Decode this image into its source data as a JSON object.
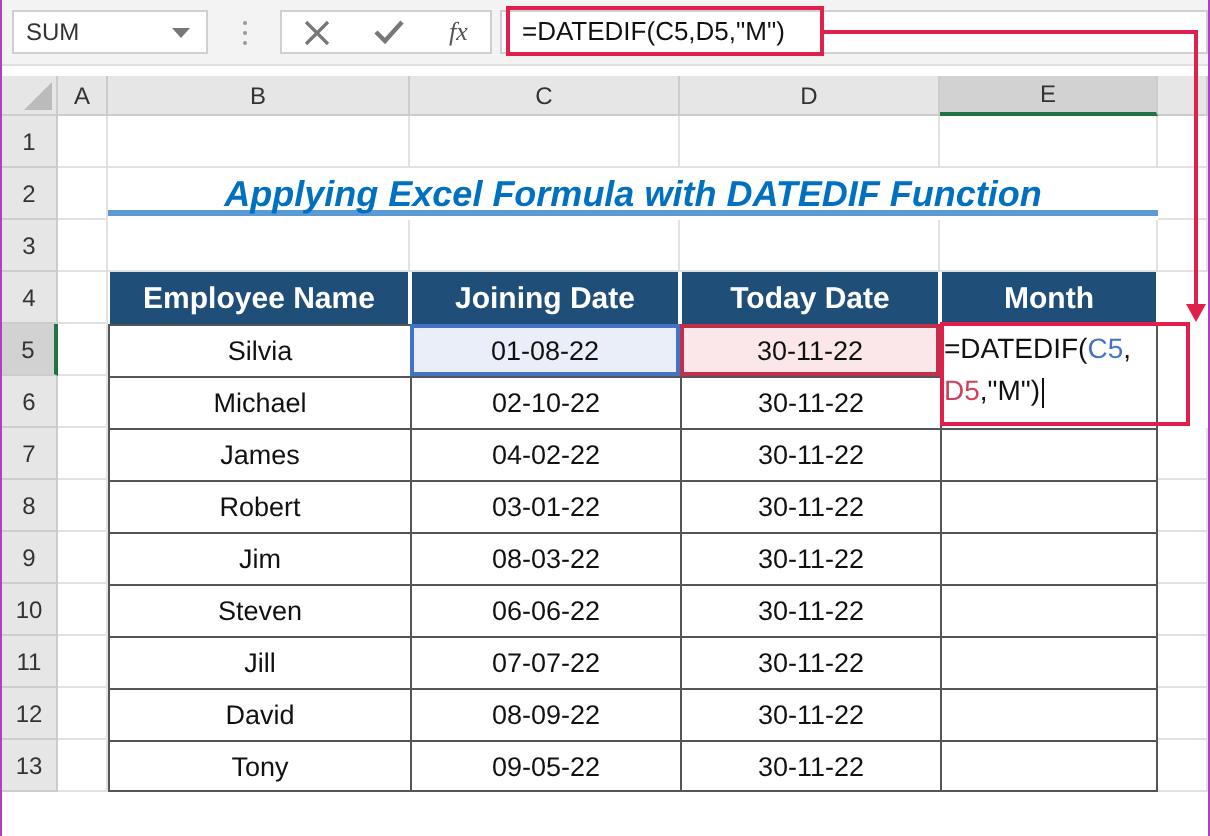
{
  "name_box": "SUM",
  "insert_function": "fx",
  "formula_bar": "=DATEDIF(C5,D5,\"M\")",
  "columns": [
    {
      "label": "A",
      "selected": false
    },
    {
      "label": "B",
      "selected": false
    },
    {
      "label": "C",
      "selected": false
    },
    {
      "label": "D",
      "selected": false
    },
    {
      "label": "E",
      "selected": true
    }
  ],
  "row_headers": [
    {
      "label": "1",
      "selected": false
    },
    {
      "label": "2",
      "selected": false
    },
    {
      "label": "3",
      "selected": false
    },
    {
      "label": "4",
      "selected": false
    },
    {
      "label": "5",
      "selected": true
    },
    {
      "label": "6",
      "selected": false
    },
    {
      "label": "7",
      "selected": false
    },
    {
      "label": "8",
      "selected": false
    },
    {
      "label": "9",
      "selected": false
    },
    {
      "label": "10",
      "selected": false
    },
    {
      "label": "11",
      "selected": false
    },
    {
      "label": "12",
      "selected": false
    },
    {
      "label": "13",
      "selected": false
    }
  ],
  "title": "Applying Excel Formula with DATEDIF Function",
  "table": {
    "columns": [
      "Employee Name",
      "Joining Date",
      "Today Date",
      "Month"
    ],
    "rows": [
      {
        "name": "Silvia",
        "joining": "01-08-22",
        "today": "30-11-22",
        "joining_highlighted": true,
        "today_highlighted": true,
        "month_formula": [
          [
            {
              "text": "=DATEDIF("
            },
            {
              "text": "C5",
              "color": "#4472c4"
            },
            {
              "text": ","
            }
          ],
          [
            {
              "text": "D5",
              "color": "#d0405a"
            },
            {
              "text": ",\"M\")"
            }
          ]
        ]
      },
      {
        "name": "Michael",
        "joining": "02-10-22",
        "today": "30-11-22",
        "joining_highlighted": false,
        "today_highlighted": false
      },
      {
        "name": "James",
        "joining": "04-02-22",
        "today": "30-11-22",
        "joining_highlighted": false,
        "today_highlighted": false
      },
      {
        "name": "Robert",
        "joining": "03-01-22",
        "today": "30-11-22",
        "joining_highlighted": false,
        "today_highlighted": false
      },
      {
        "name": "Jim",
        "joining": "08-03-22",
        "today": "30-11-22",
        "joining_highlighted": false,
        "today_highlighted": false
      },
      {
        "name": "Steven",
        "joining": "06-06-22",
        "today": "30-11-22",
        "joining_highlighted": false,
        "today_highlighted": false
      },
      {
        "name": "Jill",
        "joining": "07-07-22",
        "today": "30-11-22",
        "joining_highlighted": false,
        "today_highlighted": false
      },
      {
        "name": "David",
        "joining": "08-09-22",
        "today": "30-11-22",
        "joining_highlighted": false,
        "today_highlighted": false
      },
      {
        "name": "Tony",
        "joining": "09-05-22",
        "today": "30-11-22",
        "joining_highlighted": false,
        "today_highlighted": false
      }
    ]
  }
}
